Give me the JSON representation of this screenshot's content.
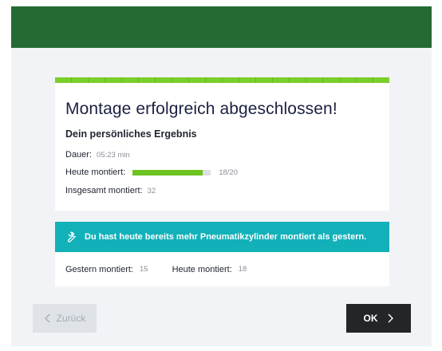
{
  "card": {
    "title": "Montage erfolgreich abgeschlossen!",
    "subtitle": "Dein persönliches Ergebnis",
    "duration_label": "Dauer:",
    "duration_value": "05:23 min",
    "today_label": "Heute montiert:",
    "today_value": "18/20",
    "today_progress_percent": 90,
    "total_label": "Insgesamt montiert:",
    "total_value": "32"
  },
  "banner": {
    "icon": "wrench-icon",
    "message": "Du hast heute bereits mehr Pneumatikzylinder montiert als gestern."
  },
  "stats": {
    "yesterday_label": "Gestern montiert:",
    "yesterday_value": "15",
    "today_label": "Heute montiert:",
    "today_value": "18"
  },
  "buttons": {
    "back_label": "Zurück",
    "ok_label": "OK"
  },
  "colors": {
    "header": "#256a33",
    "accent_green": "#7ccf2a",
    "banner_teal": "#12b1b9",
    "ok_button": "#232629"
  }
}
